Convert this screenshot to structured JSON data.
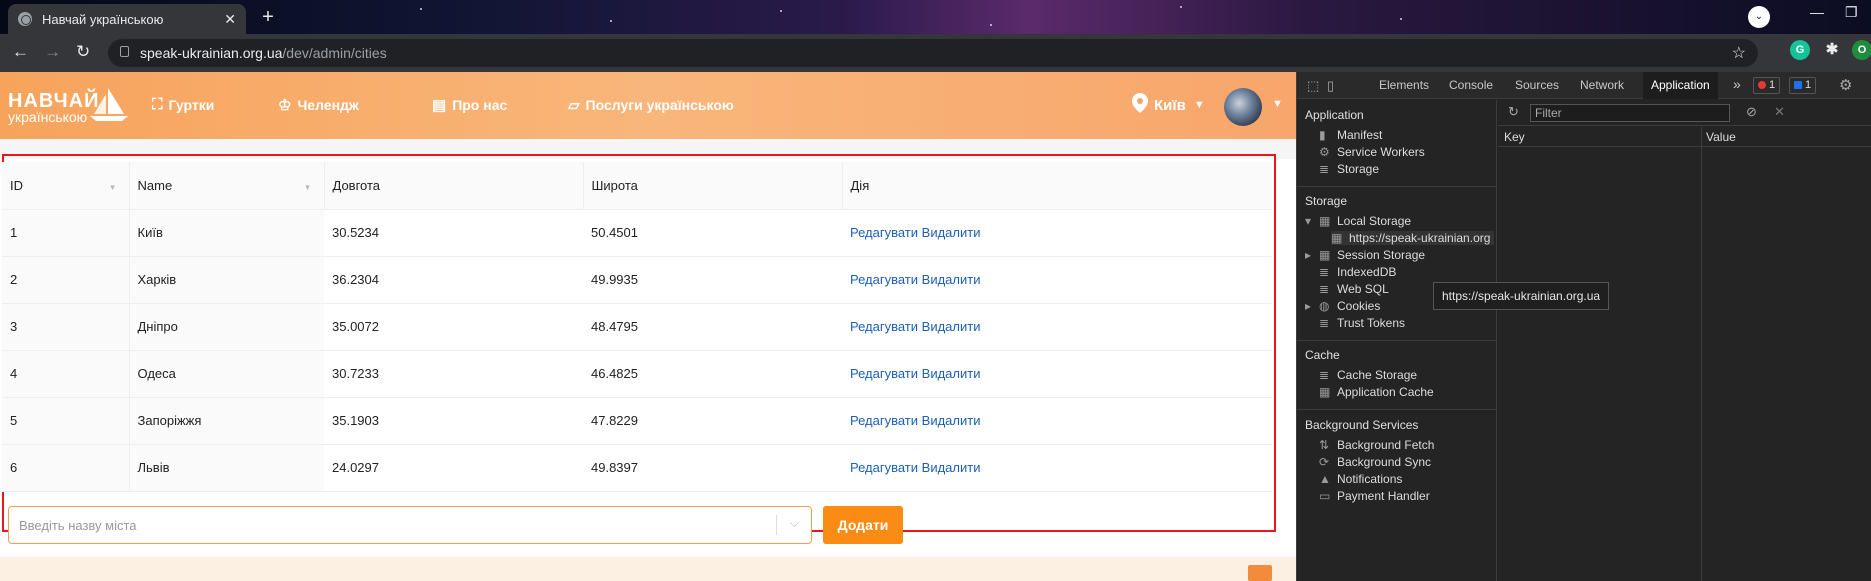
{
  "browser": {
    "tab_title": "Навчай українською",
    "tab_close": "✕",
    "new_tab": "+",
    "url_host": "speak-ukrainian.org.ua",
    "url_path": "/dev/admin/cities",
    "profile_initial": "O"
  },
  "site": {
    "logo_line1": "НАВЧАЙ",
    "logo_line2": "українською",
    "menu": [
      {
        "label": "Гуртки"
      },
      {
        "label": "Челендж"
      },
      {
        "label": "Про нас"
      },
      {
        "label": "Послуги українською"
      }
    ],
    "city": "Київ"
  },
  "table": {
    "headers": [
      "ID",
      "Name",
      "Довгота",
      "Широта",
      "Дія"
    ],
    "rows": [
      {
        "id": "1",
        "name": "Київ",
        "lon": "30.5234",
        "lat": "50.4501"
      },
      {
        "id": "2",
        "name": "Харків",
        "lon": "36.2304",
        "lat": "49.9935"
      },
      {
        "id": "3",
        "name": "Дніпро",
        "lon": "35.0072",
        "lat": "48.4795"
      },
      {
        "id": "4",
        "name": "Одеса",
        "lon": "30.7233",
        "lat": "46.4825"
      },
      {
        "id": "5",
        "name": "Запоріжжя",
        "lon": "35.1903",
        "lat": "47.8229"
      },
      {
        "id": "6",
        "name": "Львів",
        "lon": "24.0297",
        "lat": "49.8397"
      }
    ],
    "edit_label": "Редагувати",
    "delete_label": "Видалити"
  },
  "add_form": {
    "placeholder": "Введіть назву міста",
    "button_label": "Додати"
  },
  "devtools": {
    "tabs": [
      "Elements",
      "Console",
      "Sources",
      "Network",
      "Application"
    ],
    "more": "»",
    "error_count": "1",
    "message_count": "1",
    "sections": {
      "application": "Application",
      "storage": "Storage",
      "cache": "Cache",
      "background": "Background Services"
    },
    "application_items": [
      "Manifest",
      "Service Workers",
      "Storage"
    ],
    "storage_items": {
      "local_storage": "Local Storage",
      "local_storage_child": "https://speak-ukrainian.org",
      "session_storage": "Session Storage",
      "indexeddb": "IndexedDB",
      "websql": "Web SQL",
      "cookies": "Cookies",
      "trust_tokens": "Trust Tokens"
    },
    "cache_items": [
      "Cache Storage",
      "Application Cache"
    ],
    "background_items": [
      "Background Fetch",
      "Background Sync",
      "Notifications",
      "Payment Handler"
    ],
    "tooltip": "https://speak-ukrainian.org.ua",
    "filter_placeholder": "Filter",
    "kv_headers": {
      "key": "Key",
      "value": "Value"
    }
  }
}
